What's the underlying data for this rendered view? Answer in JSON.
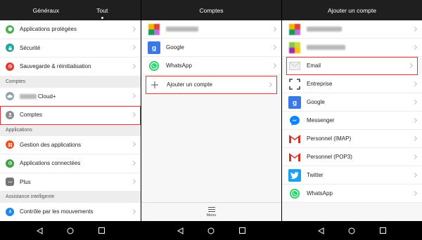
{
  "panel1": {
    "tabs": [
      {
        "label": "Généraux",
        "active": false
      },
      {
        "label": "Tout",
        "active": true
      }
    ],
    "rows_top": [
      {
        "label": "Applications protégées",
        "icon": "shield-icon",
        "color": "#4caf50"
      },
      {
        "label": "Sécurité",
        "icon": "lock-icon",
        "color": "#26a69a"
      },
      {
        "label": "Sauvegarde & réinitialisation",
        "icon": "backup-icon",
        "color": "#e53935"
      }
    ],
    "section_comptes": "Comptes",
    "cloud_row": {
      "label": "Cloud+",
      "icon": "cloud-icon",
      "color": "#90a4ae"
    },
    "comptes_row": {
      "label": "Comptes",
      "icon": "account-icon",
      "color": "#8d8d8d"
    },
    "section_applications": "Applications",
    "rows_apps": [
      {
        "label": "Gestion des applications",
        "icon": "apps-icon",
        "color": "#f4511e"
      },
      {
        "label": "Applications connectées",
        "icon": "link-icon",
        "color": "#43a047"
      },
      {
        "label": "Plus",
        "icon": "more-icon",
        "color": "#757575"
      }
    ],
    "section_assistance": "Assistance intelligente",
    "motion_row": {
      "label": "Contrôle par les mouvements",
      "icon": "motion-icon",
      "color": "#1e88e5"
    }
  },
  "panel2": {
    "title": "Comptes",
    "rows": [
      {
        "label": "Google",
        "icon": "google-icon"
      },
      {
        "label": "WhatsApp",
        "icon": "whatsapp-icon"
      }
    ],
    "add_account": "Ajouter un compte",
    "menu_label": "Menu"
  },
  "panel3": {
    "title": "Ajouter un compte",
    "email": "Email",
    "rows": [
      {
        "label": "Entreprise",
        "icon": "enterprise-icon"
      },
      {
        "label": "Google",
        "icon": "google-icon"
      },
      {
        "label": "Messenger",
        "icon": "messenger-icon"
      },
      {
        "label": "Personnel (IMAP)",
        "icon": "gmail-icon"
      },
      {
        "label": "Personnel (POP3)",
        "icon": "gmail-icon"
      },
      {
        "label": "Twitter",
        "icon": "twitter-icon"
      },
      {
        "label": "WhatsApp",
        "icon": "whatsapp-icon"
      }
    ]
  },
  "colors": {
    "header_bg": "#1f1f1f",
    "highlight": "#e0353a",
    "google_blue": "#3b78e7",
    "whatsapp_green": "#25d366",
    "messenger_blue": "#0a84ff",
    "twitter_blue": "#1da1f2",
    "gmail_red": "#d93025"
  }
}
